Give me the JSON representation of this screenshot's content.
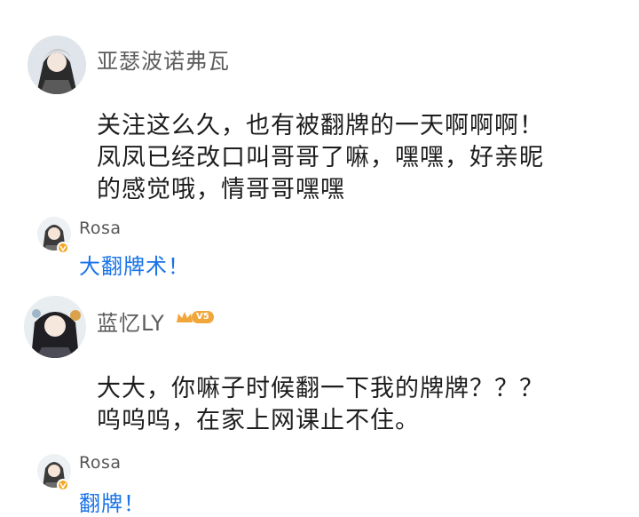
{
  "comments": [
    {
      "username": "亚瑟波诺弗瓦",
      "content_lines": [
        "关注这么久，也有被翻牌的一天啊啊啊！",
        "凤凤已经改口叫哥哥了嘛，嘿嘿，好亲昵",
        "的感觉哦，情哥哥嘿嘿"
      ],
      "reply": {
        "username": "Rosa",
        "text": "大翻牌术！"
      }
    },
    {
      "username": "蓝忆LY",
      "vip_label": "V5",
      "content_lines": [
        "大大，你嘛子时候翻一下我的牌牌？？？",
        "呜呜呜，在家上网课止不住。"
      ],
      "reply": {
        "username": "Rosa",
        "text": "翻牌！"
      }
    }
  ],
  "colors": {
    "reply_text": "#1a73e8",
    "username": "#5c5c5c",
    "verify_badge": "#f5a623",
    "vip_badge": "#f1a63b"
  }
}
